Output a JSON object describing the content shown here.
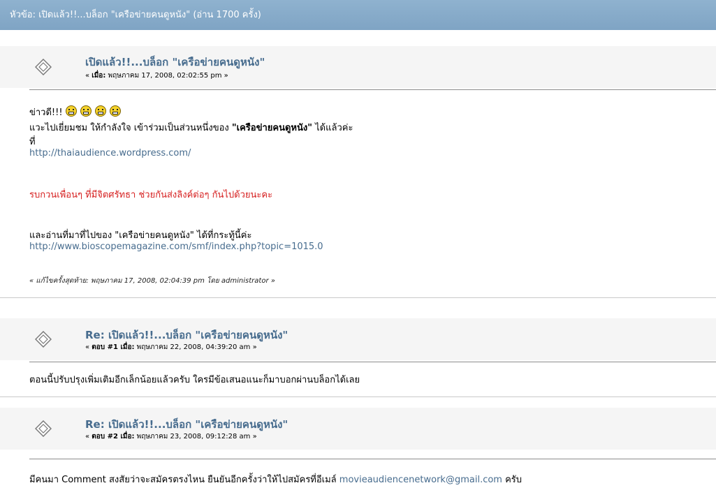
{
  "topic_bar": {
    "text": "หัวข้อ: เปิดแล้ว!!...บล็อก \"เครือข่ายคนดูหนัง\"  (อ่าน 1700 ครั้ง)"
  },
  "posts": [
    {
      "title": "เปิดแล้ว!!...บล็อก \"เครือข่ายคนดูหนัง\"",
      "meta_prefix": "« ",
      "meta_label": "เมื่อ:",
      "meta_date": " พฤษภาคม 17, 2008, 02:02:55 pm »",
      "lines": {
        "l1": "ข่าวดี!!!",
        "l2a": "แวะไปเยี่ยมชม ให้กำลังใจ เข้าร่วมเป็นส่วนหนึ่งของ ",
        "l2b": "\"เครือข่ายคนดูหนัง\"",
        "l2c": " ได้แล้วค่ะ",
        "l3": "ที่",
        "link1": "http://thaiaudience.wordpress.com/",
        "red": "รบกวนเพื่อนๆ ที่มีจิตศรัทธา ช่วยกันส่งลิงค์ต่อๆ กันไปด้วยนะคะ",
        "l5": "และอ่านที่มาที่ไปของ \"เครือข่ายคนดูหนัง\" ได้ที่กระทู้นี้ค่ะ",
        "link2": "http://www.bioscopemagazine.com/smf/index.php?topic=1015.0"
      },
      "modified": "« แก้ไขครั้งสุดท้าย: พฤษภาคม 17, 2008, 02:04:39 pm โดย administrator »"
    },
    {
      "title": "Re: เปิดแล้ว!!...บล็อก \"เครือข่ายคนดูหนัง\"",
      "meta_prefix": "« ",
      "meta_label": "ตอบ #1 เมื่อ:",
      "meta_date": " พฤษภาคม 22, 2008, 04:39:20 am »",
      "body": "ตอนนี้ปรับปรุงเพิ่มเติมอีกเล็กน้อยแล้วครับ ใครมีข้อเสนอแนะก็มาบอกผ่านบล็อกได้เลย"
    },
    {
      "title": "Re: เปิดแล้ว!!...บล็อก \"เครือข่ายคนดูหนัง\"",
      "meta_prefix": "« ",
      "meta_label": "ตอบ #2 เมื่อ:",
      "meta_date": " พฤษภาคม 23, 2008, 09:12:28 am »",
      "body_a": "มีคนมา Comment สงสัยว่าจะสมัครตรงไหน ยืนยันอีกครั้งว่าให้ไปสมัครที่อีเมล์ ",
      "body_link": "movieaudiencenetwork@gmail.com",
      "body_c": " ครับ"
    }
  ]
}
